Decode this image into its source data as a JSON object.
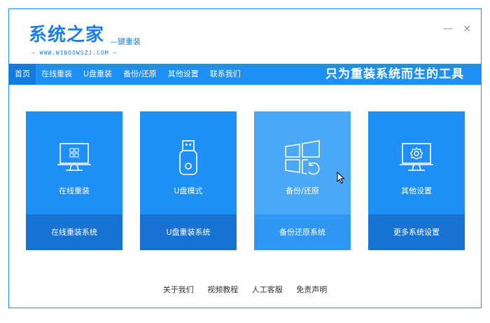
{
  "app": {
    "title": "系统之家",
    "subtitle": "—键重装",
    "url": "—  WWW.WINDOWSZJ.COM  —"
  },
  "window": {
    "minimize": "—",
    "close": "×"
  },
  "nav": {
    "items": [
      {
        "label": "首页"
      },
      {
        "label": "在线重装"
      },
      {
        "label": "U盘重装"
      },
      {
        "label": "备份/还原"
      },
      {
        "label": "其他设置"
      },
      {
        "label": "联系我们"
      }
    ],
    "slogan": "只为重装系统而生的工具"
  },
  "cards": [
    {
      "label": "在线重装",
      "action": "在线重装系统",
      "icon": "monitor-windows-icon"
    },
    {
      "label": "U盘模式",
      "action": "U盘重装系统",
      "icon": "usb-drive-icon"
    },
    {
      "label": "备份/还原",
      "action": "备份还原系统",
      "icon": "windows-restore-icon"
    },
    {
      "label": "其他设置",
      "action": "更多系统设置",
      "icon": "monitor-gear-icon"
    }
  ],
  "footer": {
    "links": [
      "关于我们",
      "视频教程",
      "人工客服",
      "免责声明"
    ]
  },
  "colors": {
    "primary": "#1e8ff5",
    "card_bottom": "#1772d1",
    "card_hover": "#4aa8f7"
  }
}
